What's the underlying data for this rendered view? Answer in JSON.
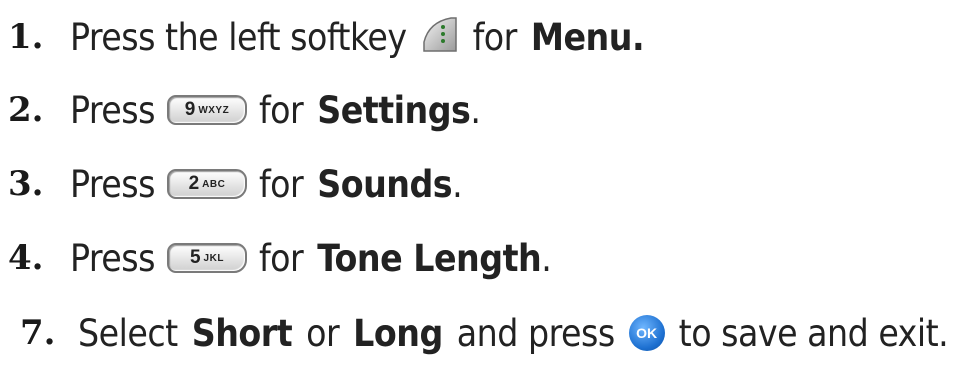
{
  "steps": [
    {
      "number": "1.",
      "before": "Press the left softkey",
      "after": "for",
      "bold": "Menu.",
      "tail": "",
      "icon": "softkey-menu-icon"
    },
    {
      "number": "2.",
      "before": "Press",
      "after": "for",
      "bold": "Settings",
      "tail": ".",
      "key_digit": "9",
      "key_letters": "WXYZ",
      "icon": "key-9-icon"
    },
    {
      "number": "3.",
      "before": "Press",
      "after": "for",
      "bold": "Sounds",
      "tail": ".",
      "key_digit": "2",
      "key_letters": "ABC",
      "icon": "key-2-icon"
    },
    {
      "number": "4.",
      "before": "Press",
      "after": "for",
      "bold": "Tone Length",
      "tail": ".",
      "key_digit": "5",
      "key_letters": "JKL",
      "icon": "key-5-icon"
    },
    {
      "number": "7.",
      "before": "Select",
      "bold_a": "Short",
      "mid": "or",
      "bold_b": "Long",
      "and": "and press",
      "ok_label": "OK",
      "after": "to save and exit.",
      "icon": "ok-button-icon"
    }
  ],
  "colors": {
    "text": "#222222",
    "ok_blue": "#1c6fd0"
  }
}
